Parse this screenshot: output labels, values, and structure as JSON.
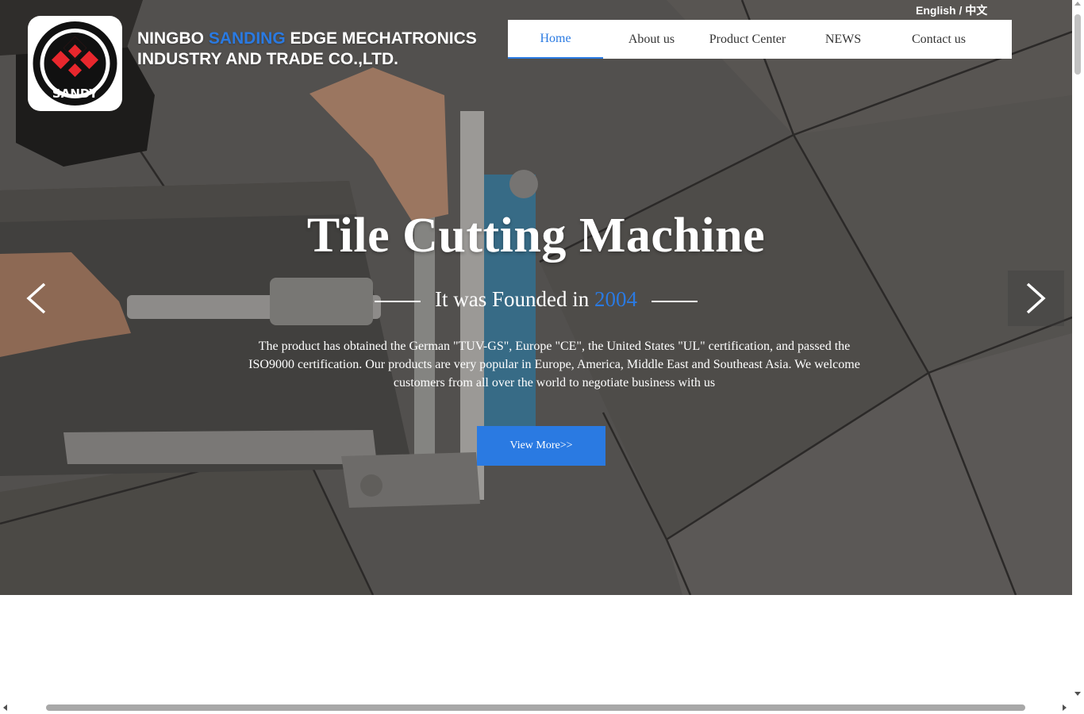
{
  "header": {
    "company_prefix": "NINGBO ",
    "company_highlight": "SANDING",
    "company_suffix": " EDGE MECHATRONICS",
    "company_line2": "INDUSTRY AND TRADE CO.,LTD.",
    "logo_text": "SANDY",
    "language": "English / 中文"
  },
  "nav": {
    "items": [
      {
        "label": "Home",
        "active": true
      },
      {
        "label": "About  us"
      },
      {
        "label": "Product Center"
      },
      {
        "label": "NEWS"
      },
      {
        "label": "Contact us"
      }
    ]
  },
  "slide": {
    "title": "Tile Cutting Machine",
    "subtitle_prefix": "It was Founded in ",
    "subtitle_year": "2004",
    "description": "The product has obtained the German \"TUV-GS\", Europe \"CE\", the United States \"UL\" certification, and passed the ISO9000 certification. Our products are very popular in Europe, America, Middle East and Southeast Asia. We welcome customers from all over the world to negotiate business with us",
    "button_label": "View More>>"
  },
  "colors": {
    "accent": "#2a7ae2",
    "logo_red": "#e8272d",
    "logo_black": "#111111"
  },
  "icons": {
    "prev": "chevron-left-icon",
    "next": "chevron-right-icon"
  }
}
